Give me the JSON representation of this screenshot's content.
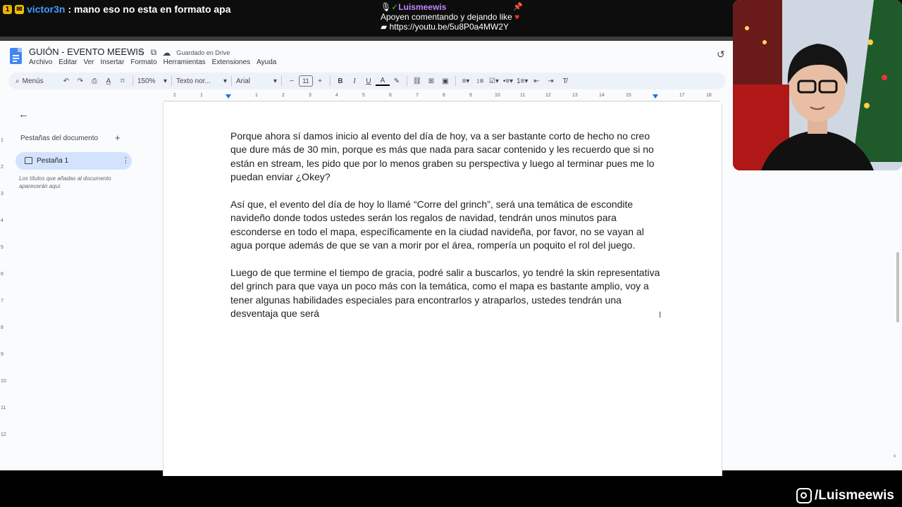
{
  "chat": {
    "badge_1": "1",
    "username": "victor3n",
    "message": ": mano eso no esta en formato apa",
    "pinned_user": "Luismeewis",
    "pinned_line1": "Apoyen comentando y dejando like",
    "pinned_link": "https://youtu.be/5u8P0a4MW2Y"
  },
  "docs": {
    "title": "GUIÓN - EVENTO MEEWIS",
    "saved_status": "Guardado en Drive",
    "menu": [
      "Archivo",
      "Editar",
      "Ver",
      "Insertar",
      "Formato",
      "Herramientas",
      "Extensiones",
      "Ayuda"
    ],
    "toolbar": {
      "search": "Menús",
      "zoom": "150%",
      "style": "Texto nor...",
      "font": "Arial",
      "font_size": "11"
    },
    "ruler_ticks": [
      "2",
      "1",
      "1",
      "2",
      "3",
      "4",
      "5",
      "6",
      "7",
      "8",
      "9",
      "10",
      "11",
      "12",
      "13",
      "14",
      "15",
      "16",
      "17",
      "18"
    ],
    "vruler_ticks": [
      "1",
      "2",
      "3",
      "4",
      "5",
      "6",
      "7",
      "8",
      "9",
      "10",
      "11",
      "12"
    ],
    "sidebar": {
      "header": "Pestañas del documento",
      "tab_label": "Pestaña 1",
      "hint": "Los títulos que añadas al documento aparecerán aquí."
    },
    "paragraphs": [
      "Porque ahora sí damos inicio al evento del día de hoy, va a ser bastante corto de hecho no creo que dure más de 30 min, porque es más que nada para sacar contenido y les recuerdo que si no están en stream, les pido que por lo menos graben su perspectiva y luego al terminar pues me lo puedan enviar ¿Okey?",
      "Así que, el evento del día de hoy lo llamé “Corre del grinch”, será una temática de escondite navideño donde todos ustedes serán los regalos de navidad, tendrán unos minutos para esconderse en todo el mapa, específicamente en la ciudad navideña, por favor, no se vayan al agua porque además de que se van a morir por el área, rompería un poquito el rol del juego.",
      "Luego de que termine el tiempo de gracia, podré salir a buscarlos, yo tendré la skin representativa del grinch para que vaya un poco más con la temática, como el mapa es bastante amplio, voy a tener algunas habilidades especiales para encontrarlos y atraparlos, ustedes tendrán una desventaja que será"
    ]
  },
  "overlay": {
    "social_handle": "/Luismeewis"
  },
  "colors": {
    "chat_username": "#3f9cff",
    "pinned_user": "#c285ff",
    "active_tab": "#d3e3fd",
    "toolbar_bg": "#edf2fa"
  }
}
